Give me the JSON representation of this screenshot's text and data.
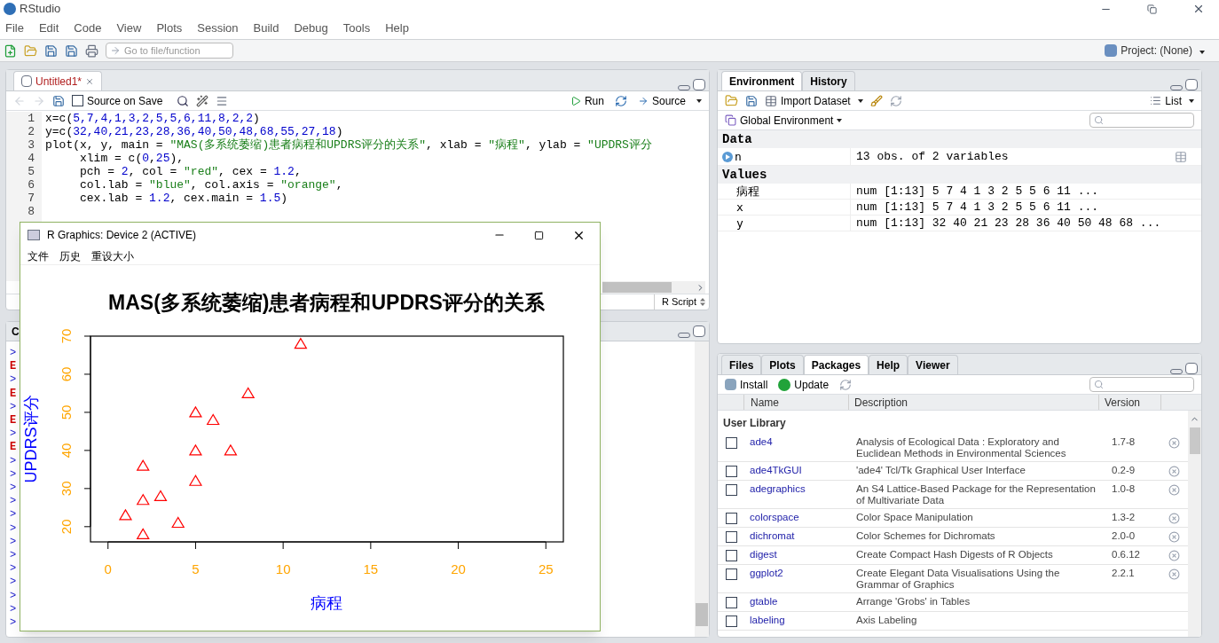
{
  "app": {
    "title": "RStudio",
    "menu": [
      "File",
      "Edit",
      "Code",
      "View",
      "Plots",
      "Session",
      "Build",
      "Debug",
      "Tools",
      "Help"
    ],
    "goto_placeholder": "Go to file/function",
    "project": "Project: (None)"
  },
  "editor": {
    "tabs": [
      {
        "label": "Untitled1*",
        "selected": true
      }
    ],
    "source_on_save": {
      "label": "Source on Save",
      "checked": false
    },
    "run": "Run",
    "source": "Source",
    "file_type": "R Script",
    "lines": [
      {
        "number": "1",
        "segments": [
          {
            "kind": "text",
            "text": "x=c("
          },
          {
            "kind": "num",
            "text": "5,7,4,1,3,2,5,5,6,11,8,2,2"
          },
          {
            "kind": "text",
            "text": ")"
          }
        ]
      },
      {
        "number": "2",
        "segments": [
          {
            "kind": "text",
            "text": "y=c("
          },
          {
            "kind": "num",
            "text": "32,40,21,23,28,36,40,50,48,68,55,27,18"
          },
          {
            "kind": "text",
            "text": ")"
          }
        ]
      },
      {
        "number": "3",
        "segments": [
          {
            "kind": "text",
            "text": "plot(x, y, main = "
          },
          {
            "kind": "str",
            "text": "\"MAS(多系统萎缩)患者病程和UPDRS评分的关系\""
          },
          {
            "kind": "text",
            "text": ", xlab = "
          },
          {
            "kind": "str",
            "text": "\"病程\""
          },
          {
            "kind": "text",
            "text": ", ylab = "
          },
          {
            "kind": "str",
            "text": "\"UPDRS评分"
          }
        ]
      },
      {
        "number": "4",
        "segments": [
          {
            "kind": "text",
            "text": "     xlim = c("
          },
          {
            "kind": "num",
            "text": "0"
          },
          {
            "kind": "text",
            "text": ","
          },
          {
            "kind": "num",
            "text": "25"
          },
          {
            "kind": "text",
            "text": "),"
          }
        ]
      },
      {
        "number": "5",
        "segments": [
          {
            "kind": "text",
            "text": "     pch = "
          },
          {
            "kind": "num",
            "text": "2"
          },
          {
            "kind": "text",
            "text": ", col = "
          },
          {
            "kind": "str",
            "text": "\"red\""
          },
          {
            "kind": "text",
            "text": ", cex = "
          },
          {
            "kind": "num",
            "text": "1.2"
          },
          {
            "kind": "text",
            "text": ","
          }
        ]
      },
      {
        "number": "6",
        "segments": [
          {
            "kind": "text",
            "text": "     col.lab = "
          },
          {
            "kind": "str",
            "text": "\"blue\""
          },
          {
            "kind": "text",
            "text": ", col.axis = "
          },
          {
            "kind": "str",
            "text": "\"orange\""
          },
          {
            "kind": "text",
            "text": ","
          }
        ]
      },
      {
        "number": "7",
        "segments": [
          {
            "kind": "text",
            "text": "     cex.lab = "
          },
          {
            "kind": "num",
            "text": "1.2"
          },
          {
            "kind": "text",
            "text": ", cex.main = "
          },
          {
            "kind": "num",
            "text": "1.5"
          },
          {
            "kind": "text",
            "text": ")"
          }
        ]
      },
      {
        "number": "8"
      }
    ]
  },
  "console": {
    "tab": "C",
    "lines": [
      {
        "kind": "prompt",
        "text": ">"
      },
      {
        "kind": "error",
        "text": "E"
      },
      {
        "kind": "prompt",
        "text": ">"
      },
      {
        "kind": "error",
        "text": "E"
      },
      {
        "kind": "prompt",
        "text": ">"
      },
      {
        "kind": "error",
        "text": "E"
      },
      {
        "kind": "prompt",
        "text": ">"
      },
      {
        "kind": "error",
        "text": "E"
      },
      {
        "kind": "prompt",
        "text": ">"
      },
      {
        "kind": "prompt",
        "text": ">"
      },
      {
        "kind": "prompt",
        "text": ">"
      },
      {
        "kind": "prompt",
        "text": ">"
      },
      {
        "kind": "prompt",
        "text": ">"
      },
      {
        "kind": "prompt",
        "text": ">"
      },
      {
        "kind": "prompt",
        "text": ">"
      },
      {
        "kind": "prompt",
        "text": ">"
      },
      {
        "kind": "prompt",
        "text": ">"
      },
      {
        "kind": "prompt",
        "text": ">"
      },
      {
        "kind": "prompt",
        "text": ">"
      },
      {
        "kind": "prompt",
        "text": ">"
      },
      {
        "kind": "prompt",
        "text": ">"
      }
    ]
  },
  "environment": {
    "tabs": [
      {
        "label": "Environment",
        "selected": true
      },
      {
        "label": "History",
        "selected": false
      }
    ],
    "import_label": "Import Dataset",
    "view_label": "List",
    "scope": "Global Environment",
    "sections": [
      {
        "title": "Data",
        "rows": [
          {
            "kind": "data",
            "name": "n",
            "value": "13 obs. of 2 variables"
          }
        ]
      },
      {
        "title": "Values",
        "rows": [
          {
            "kind": "value",
            "name": "病程",
            "value": "num [1:13] 5 7 4 1 3 2 5 5 6 11 ..."
          },
          {
            "kind": "value",
            "name": "x",
            "value": "num [1:13] 5 7 4 1 3 2 5 5 6 11 ..."
          },
          {
            "kind": "value",
            "name": "y",
            "value": "num [1:13] 32 40 21 23 28 36 40 50 48 68 ..."
          }
        ]
      }
    ]
  },
  "packages": {
    "tabs": [
      {
        "label": "Files",
        "selected": false
      },
      {
        "label": "Plots",
        "selected": false
      },
      {
        "label": "Packages",
        "selected": true
      },
      {
        "label": "Help",
        "selected": false
      },
      {
        "label": "Viewer",
        "selected": false
      }
    ],
    "install": "Install",
    "update": "Update",
    "columns": [
      "Name",
      "Description",
      "Version"
    ],
    "library": "User Library",
    "rows": [
      {
        "name": "ade4",
        "description": "Analysis of Ecological Data : Exploratory and Euclidean Methods in Environmental Sciences",
        "version": "1.7-8",
        "checked": false
      },
      {
        "name": "ade4TkGUI",
        "description": "'ade4' Tcl/Tk Graphical User Interface",
        "version": "0.2-9",
        "checked": false
      },
      {
        "name": "adegraphics",
        "description": "An S4 Lattice-Based Package for the Representation of Multivariate Data",
        "version": "1.0-8",
        "checked": false
      },
      {
        "name": "colorspace",
        "description": "Color Space Manipulation",
        "version": "1.3-2",
        "checked": false
      },
      {
        "name": "dichromat",
        "description": "Color Schemes for Dichromats",
        "version": "2.0-0",
        "checked": false
      },
      {
        "name": "digest",
        "description": "Create Compact Hash Digests of R Objects",
        "version": "0.6.12",
        "checked": false
      },
      {
        "name": "ggplot2",
        "description": "Create Elegant Data Visualisations Using the Grammar of Graphics",
        "version": "2.2.1",
        "checked": false
      },
      {
        "name": "gtable",
        "description": "Arrange 'Grobs' in Tables",
        "checked": false
      },
      {
        "name": "labeling",
        "description": "Axis Labeling",
        "checked": false
      }
    ]
  },
  "graphics_window": {
    "title": "R Graphics: Device 2 (ACTIVE)",
    "menu": [
      "文件",
      "历史",
      "重设大小"
    ],
    "chart_data": {
      "type": "scatter",
      "title": "MAS(多系统萎缩)患者病程和UPDRS评分的关系",
      "xlabel": "病程",
      "ylabel": "UPDRS评分",
      "x": [
        5,
        7,
        4,
        1,
        3,
        2,
        5,
        5,
        6,
        11,
        8,
        2,
        2
      ],
      "series": [
        {
          "color": "#ff0000",
          "values": [
            32,
            40,
            21,
            23,
            28,
            36,
            40,
            50,
            48,
            68,
            55,
            27,
            18
          ]
        }
      ],
      "xlim": [
        -1,
        26
      ],
      "ylim": [
        16,
        70
      ],
      "xticks": [
        0,
        5,
        10,
        15,
        20,
        25
      ],
      "yticks": [
        20,
        30,
        40,
        50,
        60,
        70
      ]
    }
  }
}
